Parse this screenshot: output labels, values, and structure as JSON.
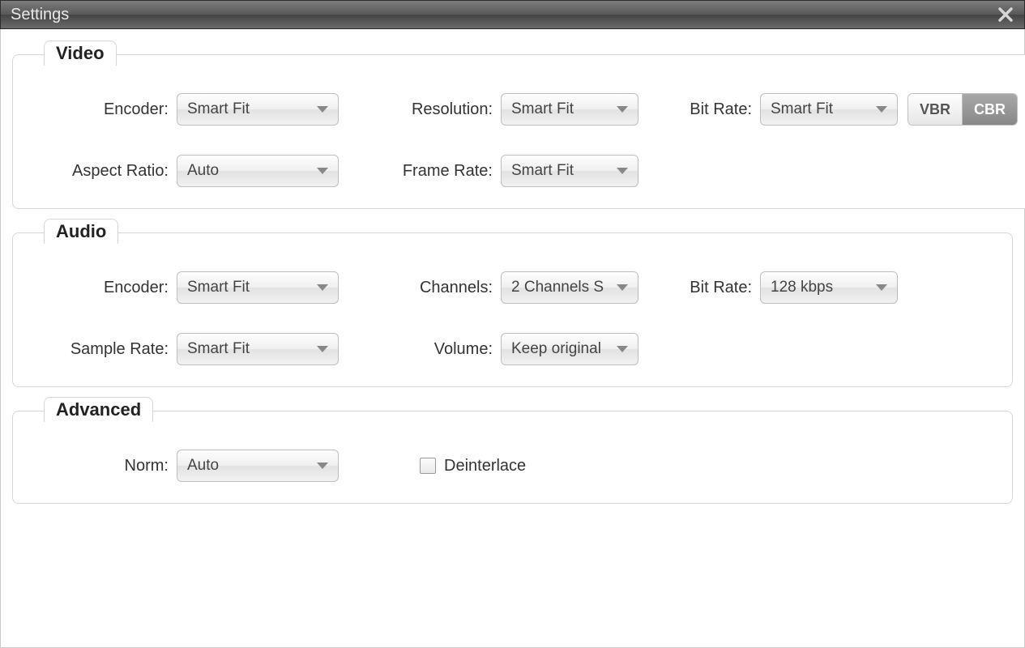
{
  "window": {
    "title": "Settings"
  },
  "video": {
    "legend": "Video",
    "encoder_label": "Encoder:",
    "encoder_value": "Smart Fit",
    "resolution_label": "Resolution:",
    "resolution_value": "Smart Fit",
    "bitrate_label": "Bit Rate:",
    "bitrate_value": "Smart Fit",
    "rate_mode": {
      "vbr": "VBR",
      "cbr": "CBR",
      "active": "CBR"
    },
    "aspect_label": "Aspect Ratio:",
    "aspect_value": "Auto",
    "framerate_label": "Frame Rate:",
    "framerate_value": "Smart Fit"
  },
  "audio": {
    "legend": "Audio",
    "encoder_label": "Encoder:",
    "encoder_value": "Smart Fit",
    "channels_label": "Channels:",
    "channels_value": "2 Channels S",
    "bitrate_label": "Bit Rate:",
    "bitrate_value": "128 kbps",
    "samplerate_label": "Sample Rate:",
    "samplerate_value": "Smart Fit",
    "volume_label": "Volume:",
    "volume_value": "Keep original"
  },
  "advanced": {
    "legend": "Advanced",
    "norm_label": "Norm:",
    "norm_value": "Auto",
    "deinterlace_label": "Deinterlace",
    "deinterlace_checked": false
  }
}
